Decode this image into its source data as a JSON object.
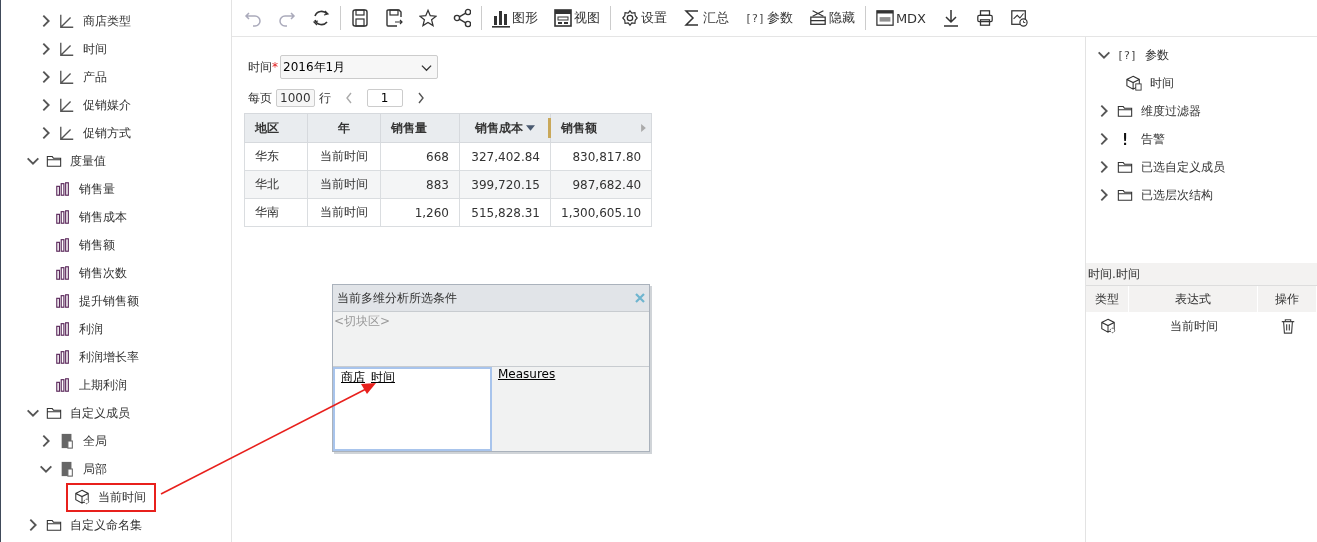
{
  "sidebar": {
    "scrolled_children": [
      {
        "label": "商店类型",
        "kind": "dimension",
        "expanded": false
      },
      {
        "label": "时间",
        "kind": "dimension",
        "expanded": false
      },
      {
        "label": "产品",
        "kind": "dimension",
        "expanded": false
      },
      {
        "label": "促销媒介",
        "kind": "dimension",
        "expanded": false
      },
      {
        "label": "促销方式",
        "kind": "dimension",
        "expanded": false
      }
    ],
    "items": [
      {
        "label": "度量值",
        "kind": "folder",
        "expanded": true,
        "children": [
          {
            "label": "销售量",
            "kind": "measure"
          },
          {
            "label": "销售成本",
            "kind": "measure"
          },
          {
            "label": "销售额",
            "kind": "measure"
          },
          {
            "label": "销售次数",
            "kind": "measure"
          },
          {
            "label": "提升销售额",
            "kind": "measure"
          },
          {
            "label": "利润",
            "kind": "measure"
          },
          {
            "label": "利润增长率",
            "kind": "measure"
          },
          {
            "label": "上期利润",
            "kind": "measure"
          }
        ]
      },
      {
        "label": "自定义成员",
        "kind": "folder",
        "expanded": true,
        "children": [
          {
            "label": "全局",
            "kind": "member",
            "expanded": false
          },
          {
            "label": "局部",
            "kind": "member",
            "expanded": true,
            "children": [
              {
                "label": "当前时间",
                "kind": "calc",
                "callout": true
              }
            ]
          }
        ]
      },
      {
        "label": "自定义命名集",
        "kind": "folder",
        "expanded": false
      }
    ]
  },
  "toolbar": [
    {
      "kind": "undo",
      "disabled": true
    },
    {
      "kind": "redo",
      "disabled": true
    },
    {
      "kind": "refresh",
      "disabled": false
    },
    {
      "kind": "separator"
    },
    {
      "kind": "save",
      "disabled": false
    },
    {
      "kind": "save-as",
      "disabled": false
    },
    {
      "kind": "star",
      "disabled": false
    },
    {
      "kind": "share",
      "disabled": false
    },
    {
      "kind": "separator"
    },
    {
      "kind": "bar-chart",
      "label": "图形",
      "disabled": false
    },
    {
      "kind": "view",
      "label": "视图",
      "disabled": false
    },
    {
      "kind": "separator"
    },
    {
      "kind": "gear",
      "label": "设置",
      "disabled": false
    },
    {
      "kind": "sigma",
      "label": "汇总",
      "disabled": false
    },
    {
      "kind": "glyph",
      "glyph": "[?]",
      "label": "参数",
      "disabled": false
    },
    {
      "kind": "hide",
      "label": "隐藏",
      "disabled": false
    },
    {
      "kind": "separator"
    },
    {
      "kind": "mdx",
      "label": "MDX",
      "disabled": false
    },
    {
      "kind": "download",
      "disabled": false
    },
    {
      "kind": "print",
      "disabled": false
    },
    {
      "kind": "schedule",
      "disabled": false
    }
  ],
  "parameter": {
    "label": "时间",
    "required_mark": "*",
    "value": "2016年1月"
  },
  "paging": {
    "prefix": "每页",
    "page_size": "1000",
    "suffix": "行",
    "page": "1"
  },
  "table": {
    "columns": [
      {
        "label": "地区",
        "sorted": false
      },
      {
        "label": "年",
        "sorted": false
      },
      {
        "label": "销售量",
        "sorted": false
      },
      {
        "label": "销售成本",
        "sorted": true
      },
      {
        "label": "销售额",
        "sorted": false
      }
    ],
    "rows": [
      [
        "华东",
        "当前时间",
        "668",
        "327,402.84",
        "830,817.80"
      ],
      [
        "华北",
        "当前时间",
        "883",
        "399,720.15",
        "987,682.40"
      ],
      [
        "华南",
        "当前时间",
        "1,260",
        "515,828.31",
        "1,300,605.10"
      ]
    ]
  },
  "dialog": {
    "title": "当前多维分析所选条件",
    "slicer": "<切块区>",
    "rows": [
      "商店",
      "时间"
    ],
    "columns": [
      "Measures"
    ]
  },
  "right_panel": {
    "tree": [
      {
        "label": "参数",
        "kind": "glyph",
        "glyph": "[?]",
        "expanded": true,
        "children": [
          {
            "label": "时间",
            "kind": "param-cube"
          }
        ]
      },
      {
        "label": "维度过滤器",
        "kind": "folder",
        "expanded": false
      },
      {
        "label": "告警",
        "kind": "glyph",
        "glyph": "!",
        "expanded": false
      },
      {
        "label": "已选自定义成员",
        "kind": "folder",
        "expanded": false
      },
      {
        "label": "已选层次结构",
        "kind": "folder",
        "expanded": false
      }
    ],
    "section_title": "时间.时间",
    "columns": [
      "类型",
      "表达式",
      "操作"
    ],
    "rows": [
      {
        "kind": "calc",
        "expression": "当前时间"
      }
    ]
  }
}
